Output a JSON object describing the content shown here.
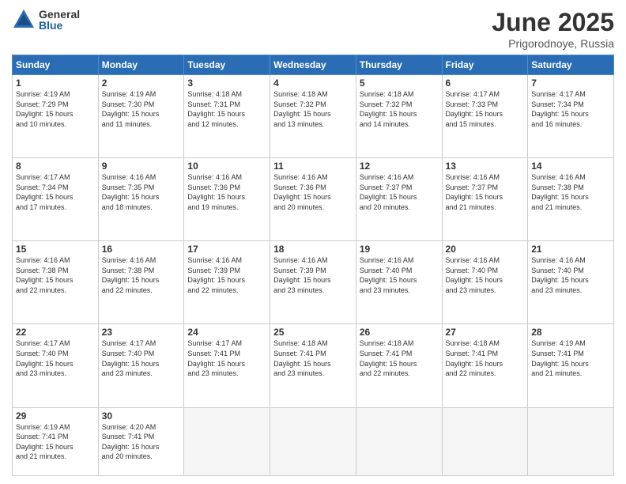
{
  "logo": {
    "general": "General",
    "blue": "Blue"
  },
  "title": {
    "month": "June 2025",
    "location": "Prigorodnoye, Russia"
  },
  "weekdays": [
    "Sunday",
    "Monday",
    "Tuesday",
    "Wednesday",
    "Thursday",
    "Friday",
    "Saturday"
  ],
  "weeks": [
    [
      {
        "day": "1",
        "info": "Sunrise: 4:19 AM\nSunset: 7:29 PM\nDaylight: 15 hours\nand 10 minutes."
      },
      {
        "day": "2",
        "info": "Sunrise: 4:19 AM\nSunset: 7:30 PM\nDaylight: 15 hours\nand 11 minutes."
      },
      {
        "day": "3",
        "info": "Sunrise: 4:18 AM\nSunset: 7:31 PM\nDaylight: 15 hours\nand 12 minutes."
      },
      {
        "day": "4",
        "info": "Sunrise: 4:18 AM\nSunset: 7:32 PM\nDaylight: 15 hours\nand 13 minutes."
      },
      {
        "day": "5",
        "info": "Sunrise: 4:18 AM\nSunset: 7:32 PM\nDaylight: 15 hours\nand 14 minutes."
      },
      {
        "day": "6",
        "info": "Sunrise: 4:17 AM\nSunset: 7:33 PM\nDaylight: 15 hours\nand 15 minutes."
      },
      {
        "day": "7",
        "info": "Sunrise: 4:17 AM\nSunset: 7:34 PM\nDaylight: 15 hours\nand 16 minutes."
      }
    ],
    [
      {
        "day": "8",
        "info": "Sunrise: 4:17 AM\nSunset: 7:34 PM\nDaylight: 15 hours\nand 17 minutes."
      },
      {
        "day": "9",
        "info": "Sunrise: 4:16 AM\nSunset: 7:35 PM\nDaylight: 15 hours\nand 18 minutes."
      },
      {
        "day": "10",
        "info": "Sunrise: 4:16 AM\nSunset: 7:36 PM\nDaylight: 15 hours\nand 19 minutes."
      },
      {
        "day": "11",
        "info": "Sunrise: 4:16 AM\nSunset: 7:36 PM\nDaylight: 15 hours\nand 20 minutes."
      },
      {
        "day": "12",
        "info": "Sunrise: 4:16 AM\nSunset: 7:37 PM\nDaylight: 15 hours\nand 20 minutes."
      },
      {
        "day": "13",
        "info": "Sunrise: 4:16 AM\nSunset: 7:37 PM\nDaylight: 15 hours\nand 21 minutes."
      },
      {
        "day": "14",
        "info": "Sunrise: 4:16 AM\nSunset: 7:38 PM\nDaylight: 15 hours\nand 21 minutes."
      }
    ],
    [
      {
        "day": "15",
        "info": "Sunrise: 4:16 AM\nSunset: 7:38 PM\nDaylight: 15 hours\nand 22 minutes."
      },
      {
        "day": "16",
        "info": "Sunrise: 4:16 AM\nSunset: 7:38 PM\nDaylight: 15 hours\nand 22 minutes."
      },
      {
        "day": "17",
        "info": "Sunrise: 4:16 AM\nSunset: 7:39 PM\nDaylight: 15 hours\nand 22 minutes."
      },
      {
        "day": "18",
        "info": "Sunrise: 4:16 AM\nSunset: 7:39 PM\nDaylight: 15 hours\nand 23 minutes."
      },
      {
        "day": "19",
        "info": "Sunrise: 4:16 AM\nSunset: 7:40 PM\nDaylight: 15 hours\nand 23 minutes."
      },
      {
        "day": "20",
        "info": "Sunrise: 4:16 AM\nSunset: 7:40 PM\nDaylight: 15 hours\nand 23 minutes."
      },
      {
        "day": "21",
        "info": "Sunrise: 4:16 AM\nSunset: 7:40 PM\nDaylight: 15 hours\nand 23 minutes."
      }
    ],
    [
      {
        "day": "22",
        "info": "Sunrise: 4:17 AM\nSunset: 7:40 PM\nDaylight: 15 hours\nand 23 minutes."
      },
      {
        "day": "23",
        "info": "Sunrise: 4:17 AM\nSunset: 7:40 PM\nDaylight: 15 hours\nand 23 minutes."
      },
      {
        "day": "24",
        "info": "Sunrise: 4:17 AM\nSunset: 7:41 PM\nDaylight: 15 hours\nand 23 minutes."
      },
      {
        "day": "25",
        "info": "Sunrise: 4:18 AM\nSunset: 7:41 PM\nDaylight: 15 hours\nand 23 minutes."
      },
      {
        "day": "26",
        "info": "Sunrise: 4:18 AM\nSunset: 7:41 PM\nDaylight: 15 hours\nand 22 minutes."
      },
      {
        "day": "27",
        "info": "Sunrise: 4:18 AM\nSunset: 7:41 PM\nDaylight: 15 hours\nand 22 minutes."
      },
      {
        "day": "28",
        "info": "Sunrise: 4:19 AM\nSunset: 7:41 PM\nDaylight: 15 hours\nand 21 minutes."
      }
    ],
    [
      {
        "day": "29",
        "info": "Sunrise: 4:19 AM\nSunset: 7:41 PM\nDaylight: 15 hours\nand 21 minutes."
      },
      {
        "day": "30",
        "info": "Sunrise: 4:20 AM\nSunset: 7:41 PM\nDaylight: 15 hours\nand 20 minutes."
      },
      {
        "day": "",
        "info": ""
      },
      {
        "day": "",
        "info": ""
      },
      {
        "day": "",
        "info": ""
      },
      {
        "day": "",
        "info": ""
      },
      {
        "day": "",
        "info": ""
      }
    ]
  ]
}
